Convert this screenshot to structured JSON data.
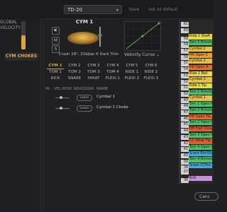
{
  "header": {
    "preset": "TD-20",
    "save_label": "Save",
    "default_label": "Set as default"
  },
  "left": {
    "line1": "GLOBAL",
    "line2": "VELOCITY",
    "chokes_label": "CYM CHOKES",
    "velocity_level": 0.5,
    "accent": "#d9a63a"
  },
  "cymbal": {
    "title": "CYM 1",
    "icons": [
      "speaker-icon",
      "M",
      "S"
    ],
    "description": "Crash 18\", Zildjian K Dark Thin",
    "curve_label": "Velocity Curve"
  },
  "grid": {
    "rows": [
      [
        "CYM 1",
        "CYM 2",
        "CYM 3",
        "CYM 4",
        "CYM 5",
        "CYM 6"
      ],
      [
        "TOM 1",
        "TOM 2",
        "TOM 3",
        "TOM 4",
        "RIDE 1",
        "RIDE 2"
      ],
      [
        "KICK",
        "SNARE",
        "HIHAT",
        "FLEXI 1",
        "FLEXI 2",
        "FLEXI 3"
      ]
    ],
    "selected": "CYM 1"
  },
  "mapping": {
    "headers": [
      "IN",
      "VEL.MOD",
      "REASSIGN",
      "NAME"
    ],
    "rows": [
      {
        "learn": "Learn",
        "name": "Cymbal 1"
      },
      {
        "learn": "Learn",
        "name": "Cymbal 1 Choke"
      }
    ]
  },
  "notes": [
    {
      "num": "61",
      "name": "",
      "color": "#7a7a7a"
    },
    {
      "num": "60",
      "name": "",
      "color": "#c8c8c8"
    },
    {
      "num": "59",
      "name": "Ride 1 Shaft",
      "color": "#e8d84a"
    },
    {
      "num": "58",
      "name": "Tom 3 Rimshot",
      "color": "#4fc06a"
    },
    {
      "num": "57",
      "name": "Cymbal 2",
      "color": "#e8c040"
    },
    {
      "num": "56",
      "name": "HH Open C",
      "color": "#e8a030"
    },
    {
      "num": "55",
      "name": "Cymbal 2",
      "color": "#e8c040"
    },
    {
      "num": "54",
      "name": "HH Open A",
      "color": "#e07030"
    },
    {
      "num": "53",
      "name": "Ride 1 Bell",
      "color": "#e8d84a"
    },
    {
      "num": "52",
      "name": "Cymbal 2",
      "color": "#e8c040"
    },
    {
      "num": "51",
      "name": "Ride 1 Tip",
      "color": "#e8d84a"
    },
    {
      "num": "50",
      "name": "Tom 1 Rimshot",
      "color": "#4fc06a"
    },
    {
      "num": "49",
      "name": "Cymbal 1",
      "color": "#e8c040"
    },
    {
      "num": "48",
      "name": "Tom 1 Open Hit",
      "color": "#4fc06a"
    },
    {
      "num": "47",
      "name": "Tom 2 Rimshot",
      "color": "#4fc06a"
    },
    {
      "num": "46",
      "name": "HH Open Tip",
      "color": "#e07030"
    },
    {
      "num": "45",
      "name": "Tom 2 Open Hit",
      "color": "#4fc06a"
    },
    {
      "num": "44",
      "name": "HH Foot Close",
      "color": "#d96030"
    },
    {
      "num": "43",
      "name": "Tom 3 Open Hit",
      "color": "#4fc06a"
    },
    {
      "num": "42",
      "name": "CC Hihat Tip",
      "color": "#d96030"
    },
    {
      "num": "41",
      "name": "Tom 4 Open Hit",
      "color": "#4fc06a"
    },
    {
      "num": "40",
      "name": "Snare RimShot",
      "color": "#4aa8e0"
    },
    {
      "num": "39",
      "name": "Tom 4 Rimshot",
      "color": "#4fc06a"
    },
    {
      "num": "38",
      "name": "Snare CCPos",
      "color": "#4aa8e0"
    },
    {
      "num": "37",
      "name": "",
      "color": "#c8c8c8"
    },
    {
      "num": "36",
      "name": "Kick",
      "color": "#c890e0"
    }
  ],
  "footer": {
    "cancel_label": "Canc"
  }
}
